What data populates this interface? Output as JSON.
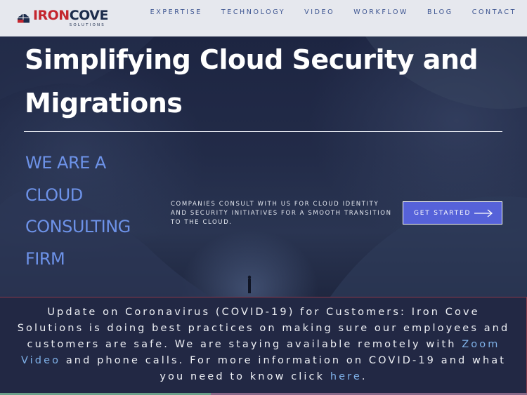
{
  "brand": {
    "name_part1": "IRON",
    "name_part2": "COVE",
    "subtitle": "SOLUTIONS",
    "colors": {
      "red": "#c4262e",
      "navy": "#1c2c4c",
      "blue": "#3d5591"
    }
  },
  "nav": {
    "items": [
      {
        "label": "EXPERTISE"
      },
      {
        "label": "TECHNOLOGY"
      },
      {
        "label": "VIDEO"
      },
      {
        "label": "WORKFLOW"
      },
      {
        "label": "BLOG"
      },
      {
        "label": "CONTACT"
      }
    ]
  },
  "hero": {
    "title_line1": "Simplifying Cloud Security and",
    "title_line2": "Migrations",
    "tagline_lines": [
      "WE ARE A",
      "CLOUD",
      "CONSULTING",
      "FIRM"
    ],
    "description_lines": [
      "COMPANIES CONSULT WITH US FOR CLOUD IDENTITY",
      "AND SECURITY INITIATIVES FOR A SMOOTH TRANSITION",
      "TO THE CLOUD."
    ],
    "cta_label": "GET STARTED",
    "cta_icon": "arrow-right-icon",
    "accent_color": "#6d92e8",
    "cta_color": "#5662d9"
  },
  "notice": {
    "text_before_link1": "Update on Coronavirus (COVID-19) for Customers: Iron Cove Solutions is doing best practices on making sure our employees and customers are safe. We are staying available remotely with ",
    "link1": "Zoom Video",
    "text_between": " and phone calls. For more information on COVID-19 and what you need to know click ",
    "link2": "here",
    "text_after": ".",
    "link_color": "#7fb1e8"
  }
}
